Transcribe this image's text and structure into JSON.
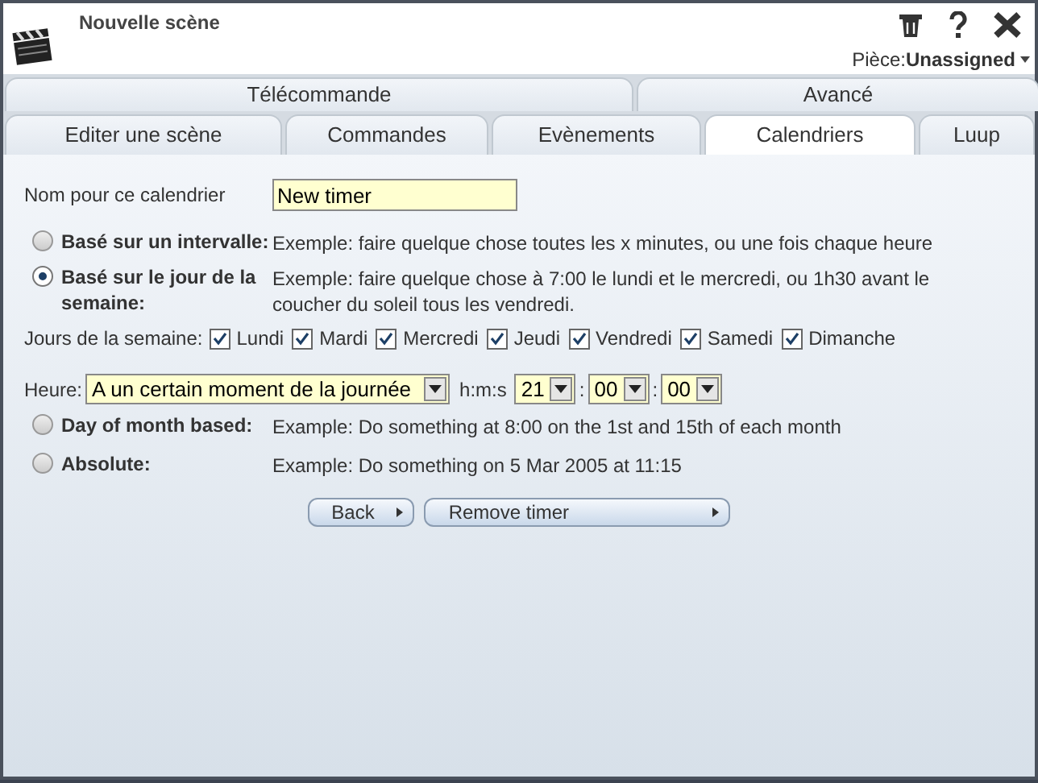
{
  "window": {
    "title": "Nouvelle scène"
  },
  "room": {
    "label": "Pièce:",
    "value": "Unassigned"
  },
  "tab_rows": [
    [
      {
        "label": "Télécommande",
        "selected": false
      },
      {
        "label": "Avancé",
        "selected": false
      }
    ],
    [
      {
        "label": "Editer une scène",
        "selected": false
      },
      {
        "label": "Commandes",
        "selected": false
      },
      {
        "label": "Evènements",
        "selected": false
      },
      {
        "label": "Calendriers",
        "selected": true
      },
      {
        "label": "Luup",
        "selected": false
      }
    ]
  ],
  "name_field": {
    "label": "Nom pour ce calendrier",
    "value": "New timer"
  },
  "modes": [
    {
      "label": "Basé sur un intervalle:",
      "selected": false,
      "example": "Exemple: faire quelque chose toutes les x minutes, ou une fois chaque heure"
    },
    {
      "label": "Basé sur le jour de la semaine:",
      "selected": true,
      "example": "Exemple: faire quelque chose à 7:00 le lundi et le mercredi, ou 1h30 avant le coucher du soleil tous les vendredi."
    }
  ],
  "weekdays": {
    "label": "Jours de la semaine:",
    "days": [
      {
        "label": "Lundi",
        "checked": true
      },
      {
        "label": "Mardi",
        "checked": true
      },
      {
        "label": "Mercredi",
        "checked": true
      },
      {
        "label": "Jeudi",
        "checked": true
      },
      {
        "label": "Vendredi",
        "checked": true
      },
      {
        "label": "Samedi",
        "checked": true
      },
      {
        "label": "Dimanche",
        "checked": true
      }
    ]
  },
  "time": {
    "label": "Heure:",
    "mode": "A un certain moment de la journée",
    "hms_label": "h:m:s",
    "hour": "21",
    "minute": "00",
    "second": "00",
    "separators": [
      ":",
      ":"
    ]
  },
  "other_modes": [
    {
      "label": "Day of month based:",
      "selected": false,
      "example": "Example: Do something at 8:00 on the 1st and 15th of each month"
    },
    {
      "label": "Absolute:",
      "selected": false,
      "example": "Example: Do something on 5 Mar 2005 at 11:15"
    }
  ],
  "buttons": [
    "Back",
    "Remove timer"
  ]
}
